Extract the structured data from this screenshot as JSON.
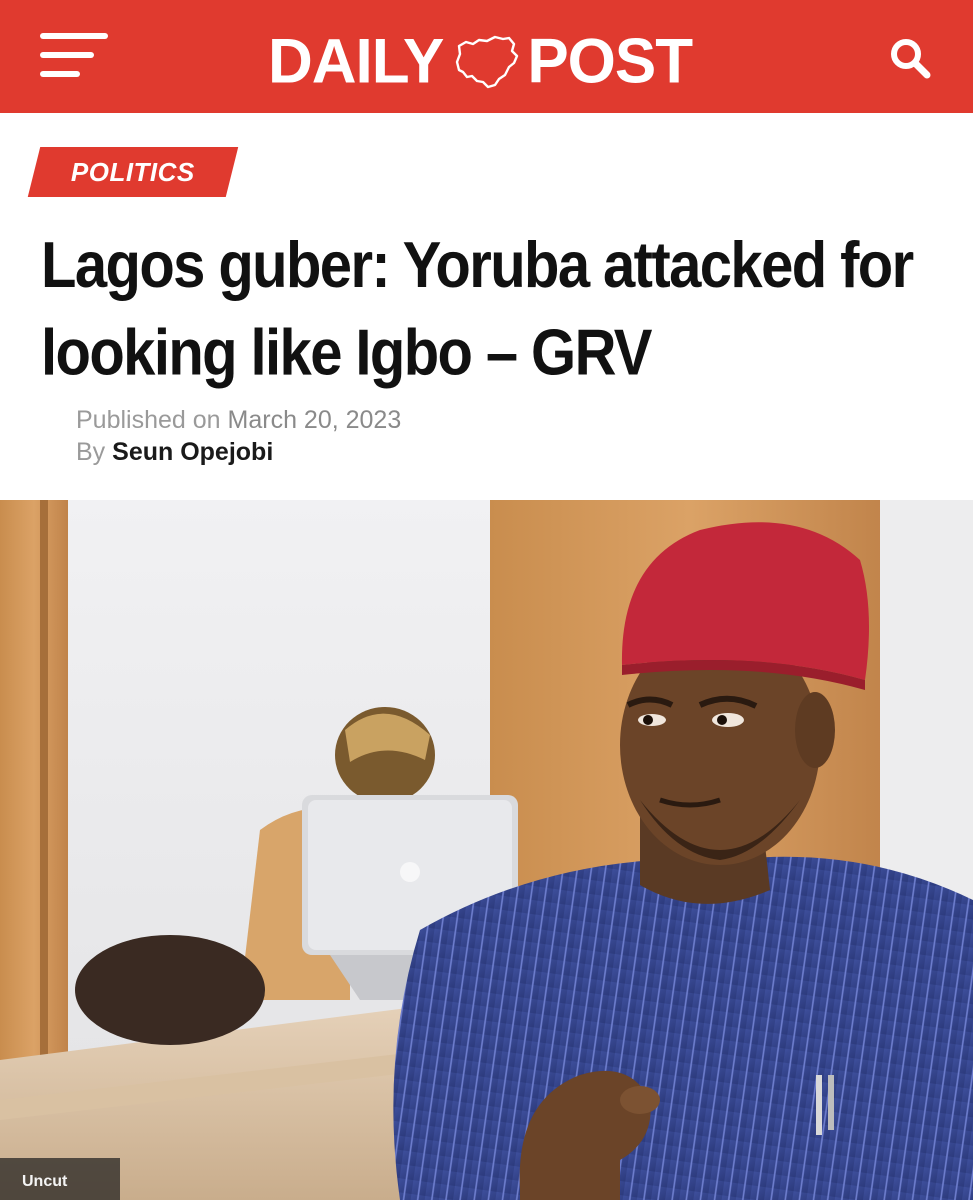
{
  "header": {
    "logo_left": "DAILY",
    "logo_right": "POST",
    "brand_color": "#e03a2f",
    "menu_icon": "hamburger-menu-icon",
    "search_icon": "search-icon"
  },
  "article": {
    "category": "POLITICS",
    "title_line1": "Lagos guber: Yoruba attacked for",
    "title_line2": "looking like Igbo – GRV",
    "published_label": "Published on",
    "published_date": "March 20, 2023",
    "by_label": "By",
    "author": "Seun Opejobi"
  },
  "photo": {
    "watermark": "Uncut"
  }
}
